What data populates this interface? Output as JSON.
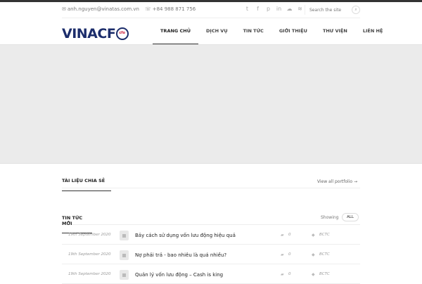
{
  "contact": {
    "email": "anh.nguyen@vinatas.com.vn",
    "phone": "+84 988 871 756"
  },
  "socials": [
    "twitter-icon",
    "facebook-icon",
    "pinterest-icon",
    "linkedin-icon",
    "cloud-icon",
    "rss-icon"
  ],
  "search": {
    "placeholder": "Search the site"
  },
  "logo": {
    "text": "VINACF",
    "mark": "cfo"
  },
  "nav": [
    "TRANG CHỦ",
    "DỊCH VỤ",
    "TIN TỨC",
    "GIỚI THIỆU",
    "THƯ VIỆN",
    "LIÊN HỆ"
  ],
  "section1": {
    "title": "TÀI LIỆU CHIA SẺ",
    "link": "View all portfolio →"
  },
  "section2": {
    "title": "TIN TỨC MỚI",
    "showing": "Showing",
    "filter": "ALL"
  },
  "posts": [
    {
      "date": "19th September 2020",
      "title": "Bảy cách sử dụng vốn lưu động hiệu quả",
      "comments": "0",
      "tag": "BCTC"
    },
    {
      "date": "19th September 2020",
      "title": "Nợ phải trả - bao nhiêu là quá nhiều?",
      "comments": "0",
      "tag": "BCTC"
    },
    {
      "date": "19th September 2020",
      "title": "Quản lý vốn lưu động – Cash is king",
      "comments": "0",
      "tag": "BCTC"
    }
  ]
}
